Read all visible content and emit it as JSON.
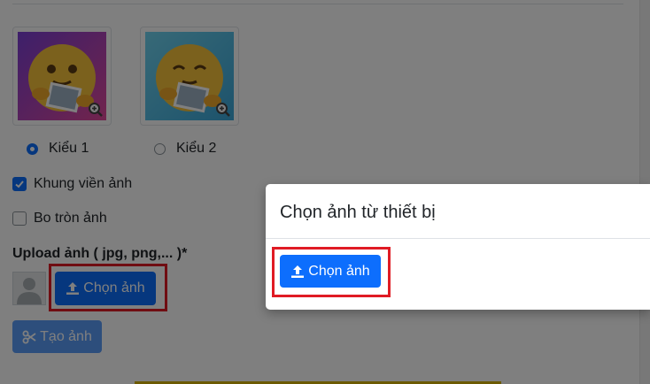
{
  "styles": {
    "option_1_label": "Kiểu 1",
    "option_2_label": "Kiểu 2",
    "selected": 1
  },
  "options": {
    "frame_label": "Khung viền ảnh",
    "frame_checked": true,
    "round_label": "Bo tròn ảnh",
    "round_checked": false
  },
  "upload": {
    "label": "Upload ảnh ( jpg, png,... )*",
    "choose_button": "Chọn ảnh"
  },
  "create_button": "Tạo ảnh",
  "modal": {
    "title": "Chọn ảnh từ thiết bị",
    "choose_button": "Chọn ảnh"
  },
  "colors": {
    "primary": "#0d6efd",
    "highlight": "#e01b24"
  },
  "icons": {
    "zoom": "zoom-in-icon",
    "upload": "upload-icon",
    "scissors": "scissors-icon",
    "avatar": "user-silhouette-icon"
  }
}
